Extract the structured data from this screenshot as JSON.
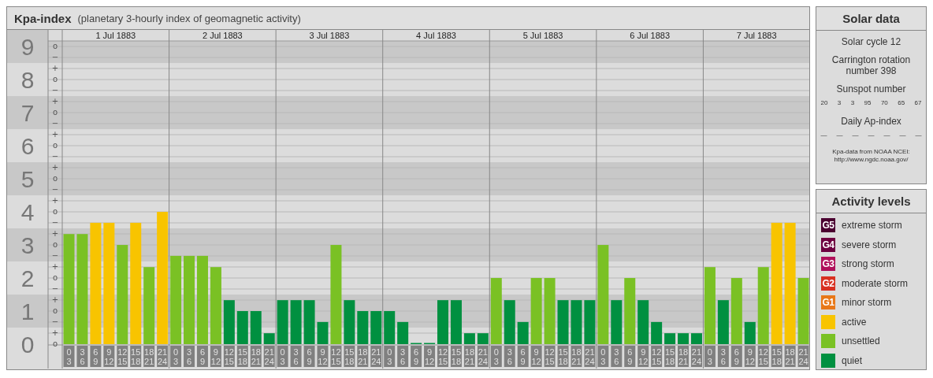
{
  "chart": {
    "title": "Kpa-index",
    "subtitle": "(planetary 3-hourly index of geomagnetic activity)",
    "days": [
      "1 Jul 1883",
      "2 Jul 1883",
      "3 Jul 1883",
      "4 Jul 1883",
      "5 Jul 1883",
      "6 Jul 1883",
      "7 Jul 1883"
    ],
    "sub_marks": [
      "o",
      "−",
      "+",
      "o",
      "−",
      "+",
      "o",
      "−",
      "+",
      "o",
      "−",
      "+",
      "o",
      "−",
      "+",
      "o",
      "−",
      "+",
      "o",
      "−",
      "+",
      "o",
      "−",
      "+",
      "o",
      "−",
      "+",
      "o"
    ],
    "chart_data": {
      "type": "bar",
      "grid": true,
      "yticks": [
        0,
        1,
        2,
        3,
        4,
        5,
        6,
        7,
        8,
        9
      ],
      "ylim": [
        0,
        9.17
      ],
      "categories": [
        "0\n3",
        "3\n6",
        "6\n9",
        "9\n12",
        "12\n15",
        "15\n18",
        "18\n21",
        "21\n24",
        "0\n3",
        "3\n6",
        "6\n9",
        "9\n12",
        "12\n15",
        "15\n18",
        "18\n21",
        "21\n24",
        "0\n3",
        "3\n6",
        "6\n9",
        "9\n12",
        "12\n15",
        "15\n18",
        "18\n21",
        "21\n24",
        "0\n3",
        "3\n6",
        "6\n9",
        "9\n12",
        "12\n15",
        "15\n18",
        "18\n21",
        "21\n24",
        "0\n3",
        "3\n6",
        "6\n9",
        "9\n12",
        "12\n15",
        "15\n18",
        "18\n21",
        "21\n24",
        "0\n3",
        "3\n6",
        "6\n9",
        "9\n12",
        "12\n15",
        "15\n18",
        "18\n21",
        "21\n24",
        "0\n3",
        "3\n6",
        "6\n9",
        "9\n12",
        "12\n15",
        "15\n18",
        "18\n21",
        "21\n24"
      ],
      "series": [
        {
          "name": "active",
          "color": "#f8c400",
          "values": [
            null,
            null,
            3.67,
            3.67,
            null,
            3.67,
            null,
            4,
            null,
            null,
            null,
            null,
            null,
            null,
            null,
            null,
            null,
            null,
            null,
            null,
            null,
            null,
            null,
            null,
            null,
            null,
            null,
            null,
            null,
            null,
            null,
            null,
            null,
            null,
            null,
            null,
            null,
            null,
            null,
            null,
            null,
            null,
            null,
            null,
            null,
            null,
            null,
            null,
            null,
            null,
            null,
            null,
            null,
            3.67,
            3.67,
            null
          ]
        },
        {
          "name": "unsettled",
          "color": "#7ac124",
          "values": [
            3.33,
            3.33,
            null,
            null,
            3,
            null,
            2.33,
            null,
            2.67,
            2.67,
            2.67,
            2.33,
            null,
            null,
            null,
            null,
            null,
            null,
            null,
            null,
            3,
            null,
            null,
            null,
            null,
            null,
            null,
            null,
            null,
            null,
            null,
            null,
            2,
            null,
            null,
            2,
            2,
            null,
            null,
            null,
            3,
            null,
            2,
            null,
            null,
            null,
            null,
            null,
            2.33,
            null,
            2,
            null,
            2.33,
            null,
            null,
            2
          ]
        },
        {
          "name": "quiet",
          "color": "#009040",
          "values": [
            null,
            null,
            null,
            null,
            null,
            null,
            null,
            null,
            null,
            null,
            null,
            null,
            1.33,
            1,
            1,
            0.33,
            1.33,
            1.33,
            1.33,
            0.67,
            null,
            1.33,
            1,
            1,
            1,
            0.67,
            0,
            0,
            1.33,
            1.33,
            0.33,
            0.33,
            null,
            1.33,
            0.67,
            null,
            null,
            1.33,
            1.33,
            1.33,
            null,
            1.33,
            null,
            1.33,
            0.67,
            0.33,
            0.33,
            0.33,
            null,
            1.33,
            null,
            0.67,
            null,
            null,
            null,
            null
          ]
        }
      ]
    }
  },
  "solar": {
    "title": "Solar data",
    "cycle": "Solar cycle 12",
    "rotation": "Carrington rotation number 398",
    "sunspot_label": "Sunspot number",
    "sunspots": [
      "20",
      "3",
      "3",
      "95",
      "70",
      "65",
      "67"
    ],
    "ap_label": "Daily Ap-index",
    "ap_values": [
      "—",
      "—",
      "—",
      "—",
      "—",
      "—",
      "—"
    ],
    "source": "Kpa-data from NOAA NCEI:",
    "source_url": "http://www.ngdc.noaa.gov/"
  },
  "legend": {
    "title": "Activity levels",
    "items": [
      {
        "badge": "G5",
        "label": "extreme storm",
        "color": "#4a0030"
      },
      {
        "badge": "G4",
        "label": "severe storm",
        "color": "#6e0040"
      },
      {
        "badge": "G3",
        "label": "strong storm",
        "color": "#b0105a"
      },
      {
        "badge": "G2",
        "label": "moderate storm",
        "color": "#d83020"
      },
      {
        "badge": "G1",
        "label": "minor storm",
        "color": "#e87818"
      }
    ]
  }
}
